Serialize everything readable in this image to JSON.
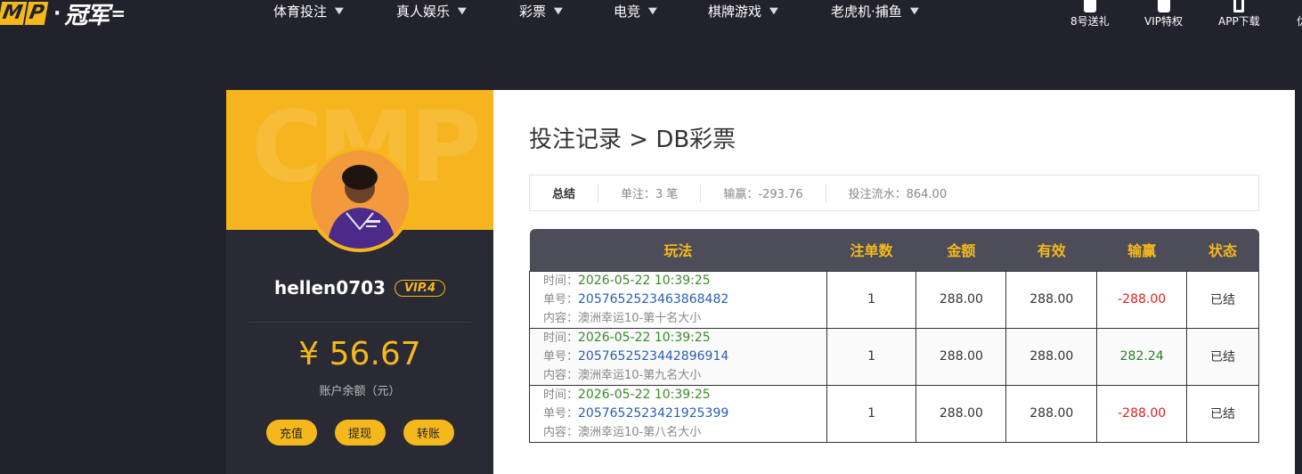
{
  "logo": {
    "letters": "MP",
    "brand": "冠军"
  },
  "nav": {
    "items": [
      {
        "label": "体育投注"
      },
      {
        "label": "真人娱乐"
      },
      {
        "label": "彩票"
      },
      {
        "label": "电竞"
      },
      {
        "label": "棋牌游戏"
      },
      {
        "label": "老虎机·捕鱼"
      }
    ],
    "utilities": [
      {
        "label": "8号送礼",
        "icon": "gift-icon"
      },
      {
        "label": "VIP特权",
        "icon": "crown-icon"
      },
      {
        "label": "APP下载",
        "icon": "phone-icon"
      },
      {
        "label": "优",
        "icon": "offer-icon"
      }
    ]
  },
  "profile": {
    "banner_watermark": "CMP",
    "username": "hellen0703",
    "vip": "VIP.4",
    "balance": "¥ 56.67",
    "balance_label": "账户余额（元）",
    "actions": [
      "充值",
      "提现",
      "转账"
    ]
  },
  "main": {
    "breadcrumb": "投注记录 > DB彩票",
    "summary": {
      "title": "总结",
      "count": "单注：3 笔",
      "profit": "输赢：-293.76",
      "turnover": "投注流水：864.00"
    },
    "table": {
      "headers": [
        "玩法",
        "注单数",
        "金额",
        "有效",
        "输赢",
        "状态"
      ],
      "labels": {
        "time": "时间：",
        "no": "单号：",
        "content": "内容："
      },
      "rows": [
        {
          "time": "2026-05-22 10:39:25",
          "no": "2057652523463868482",
          "content": "澳洲幸运10-第十名大小",
          "count": "1",
          "amount": "288.00",
          "valid": "288.00",
          "result": "-288.00",
          "status": "已结"
        },
        {
          "time": "2026-05-22 10:39:25",
          "no": "2057652523442896914",
          "content": "澳洲幸运10-第九名大小",
          "count": "1",
          "amount": "288.00",
          "valid": "288.00",
          "result": "282.24",
          "status": "已结"
        },
        {
          "time": "2026-05-22 10:39:25",
          "no": "2057652523421925399",
          "content": "澳洲幸运10-第八名大小",
          "count": "1",
          "amount": "288.00",
          "valid": "288.00",
          "result": "-288.00",
          "status": "已结"
        }
      ]
    }
  },
  "colors": {
    "accent": "#f5b81c",
    "background": "#22222c",
    "loss": "#e02020",
    "win": "#2a7d2a"
  }
}
